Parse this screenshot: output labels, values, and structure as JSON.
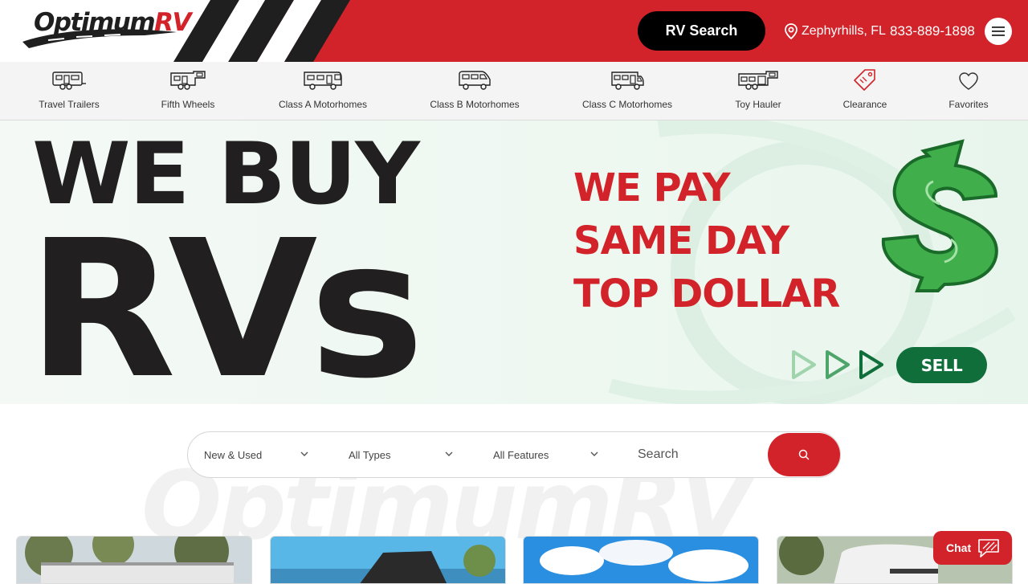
{
  "header": {
    "logo_main": "Optimum",
    "logo_accent": "RV",
    "rv_search_label": "RV Search",
    "location": "Zephyrhills, FL",
    "phone": "833-889-1898",
    "menu_icon": "hamburger-icon"
  },
  "categories": [
    {
      "label": "Travel Trailers",
      "icon": "travel-trailer-icon"
    },
    {
      "label": "Fifth Wheels",
      "icon": "fifth-wheel-icon"
    },
    {
      "label": "Class A Motorhomes",
      "icon": "class-a-icon"
    },
    {
      "label": "Class B Motorhomes",
      "icon": "class-b-icon"
    },
    {
      "label": "Class C Motorhomes",
      "icon": "class-c-icon"
    },
    {
      "label": "Toy Hauler",
      "icon": "toy-hauler-icon"
    },
    {
      "label": "Clearance",
      "icon": "price-tag-icon"
    },
    {
      "label": "Favorites",
      "icon": "heart-icon"
    }
  ],
  "hero": {
    "line1": "WE BUY",
    "line2": "RVs",
    "pay1": "WE PAY",
    "pay2": "SAME DAY",
    "pay3": "TOP DOLLAR",
    "sell_label": "SELL",
    "colors": {
      "red": "#d2232a",
      "green": "#0f6e3a",
      "dark": "#211f1f"
    }
  },
  "search": {
    "condition": "New & Used",
    "type": "All Types",
    "features": "All Features",
    "placeholder": "Search",
    "watermark": "OptimumRV"
  },
  "chat": {
    "label": "Chat"
  }
}
